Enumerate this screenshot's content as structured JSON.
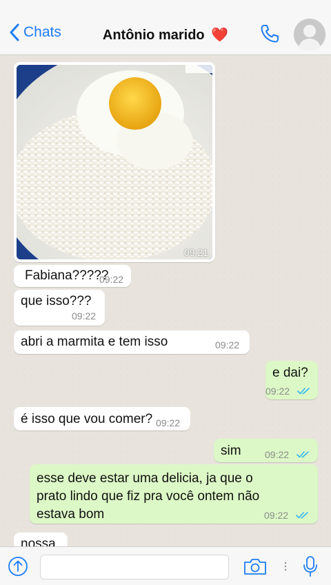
{
  "header": {
    "back_label": "Chats",
    "contact_name": "Antônio marido",
    "contact_emoji": "❤️"
  },
  "messages": [
    {
      "type": "image",
      "direction": "in",
      "time": "09:21",
      "image": "fried-egg-on-rice-plate"
    },
    {
      "type": "text",
      "direction": "in",
      "text": "Fabiana?????",
      "time": "09:22"
    },
    {
      "type": "text",
      "direction": "in",
      "text": "que isso???",
      "time": "09:22"
    },
    {
      "type": "text",
      "direction": "in",
      "text": "abri a marmita e tem isso",
      "time": "09:22"
    },
    {
      "type": "text",
      "direction": "out",
      "text": "e dai?",
      "time": "09:22",
      "status": "read"
    },
    {
      "type": "text",
      "direction": "in",
      "text": "é isso que vou comer?",
      "time": "09:22"
    },
    {
      "type": "text",
      "direction": "out",
      "text": "sim",
      "time": "09:22",
      "status": "read"
    },
    {
      "type": "text",
      "direction": "out",
      "lines": [
        "esse deve estar uma delicia, ja que o",
        "prato lindo que fiz pra você ontem não",
        "estava bom"
      ],
      "time": "09:22",
      "status": "read"
    },
    {
      "type": "text",
      "direction": "in",
      "text": "nossa",
      "time": ""
    }
  ],
  "colors": {
    "accent": "#1b7cf6",
    "incoming_bubble": "#ffffff",
    "outgoing_bubble": "#dcf8c6",
    "chat_background": "#e8e4dd",
    "read_ticks": "#34b7f1"
  },
  "input": {
    "placeholder": ""
  }
}
